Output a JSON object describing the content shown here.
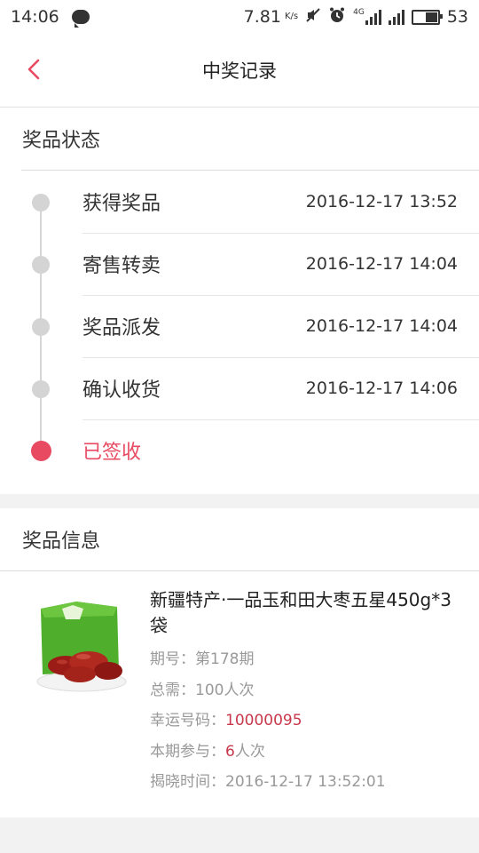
{
  "status_bar": {
    "time": "14:06",
    "speed": "7.81",
    "speed_unit": "K/s",
    "network": "4G",
    "battery": "53",
    "battery_level": 0.53
  },
  "nav": {
    "title": "中奖记录",
    "back_icon": "chevron-left-icon"
  },
  "status_section": {
    "title": "奖品状态",
    "steps": [
      {
        "label": "获得奖品",
        "time": "2016-12-17 13:52"
      },
      {
        "label": "寄售转卖",
        "time": "2016-12-17 14:04"
      },
      {
        "label": "奖品派发",
        "time": "2016-12-17 14:04"
      },
      {
        "label": "确认收货",
        "time": "2016-12-17 14:06"
      },
      {
        "label": "已签收",
        "time": ""
      }
    ]
  },
  "info_section": {
    "title": "奖品信息",
    "product": {
      "title": "新疆特产·一品玉和田大枣五星450g*3袋",
      "period_label": "期号：",
      "period_value": "第178期",
      "total_label": "总需：",
      "total_value": "100人次",
      "lucky_label": "幸运号码：",
      "lucky_value": "10000095",
      "joined_label": "本期参与：",
      "joined_count": "6",
      "joined_unit": "人次",
      "reveal_label": "揭晓时间：",
      "reveal_value": "2016-12-17 13:52:01"
    }
  },
  "colors": {
    "accent": "#e84a62",
    "inactive_dot": "#d4d4d4",
    "highlight_text": "#c8384b"
  }
}
